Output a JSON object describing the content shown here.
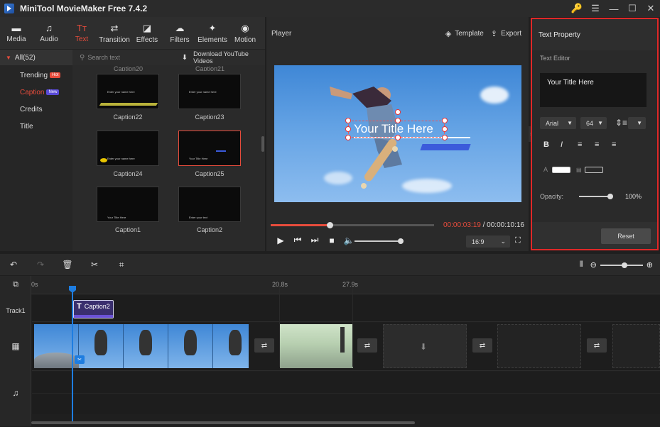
{
  "app": {
    "title": "MiniTool MovieMaker Free 7.4.2"
  },
  "toolbar": [
    {
      "label": "Media",
      "icon": "folder-icon",
      "glyph": "▬"
    },
    {
      "label": "Audio",
      "icon": "music-note-icon",
      "glyph": "♫"
    },
    {
      "label": "Text",
      "icon": "text-icon",
      "glyph": "Tт",
      "active": true
    },
    {
      "label": "Transition",
      "icon": "transition-icon",
      "glyph": "⇄"
    },
    {
      "label": "Effects",
      "icon": "effects-icon",
      "glyph": "◪"
    },
    {
      "label": "Filters",
      "icon": "filters-icon",
      "glyph": "☁"
    },
    {
      "label": "Elements",
      "icon": "elements-icon",
      "glyph": "✦"
    },
    {
      "label": "Motion",
      "icon": "motion-icon",
      "glyph": "◉"
    }
  ],
  "categories": {
    "header": "All(52)",
    "items": [
      {
        "label": "Trending",
        "badge": "Hot"
      },
      {
        "label": "Caption",
        "badge": "New",
        "active": true
      },
      {
        "label": "Credits"
      },
      {
        "label": "Title"
      }
    ]
  },
  "library": {
    "search_placeholder": "Search text",
    "youtube_label": "Download YouTube Videos",
    "partial_labels": [
      "Caption20",
      "Caption21"
    ],
    "items": [
      {
        "label": "Caption22",
        "preview": "Enter your name here"
      },
      {
        "label": "Caption23",
        "preview": "Enter your name here"
      },
      {
        "label": "Caption24",
        "preview": "Enter your name here"
      },
      {
        "label": "Caption25",
        "preview": "Your Title Here",
        "selected": true
      },
      {
        "label": "Caption1",
        "preview": "Your Title Here"
      },
      {
        "label": "Caption2",
        "preview": "Enter your text"
      }
    ]
  },
  "player": {
    "label": "Player",
    "template_label": "Template",
    "export_label": "Export",
    "overlay_title": "Your Title Here",
    "current_time": "00:00:03:19",
    "total_time": "/ 00:00:10:16",
    "aspect_ratio": "16:9",
    "progress_fraction": 0.36,
    "volume_fraction": 1.0
  },
  "text_property": {
    "header": "Text Property",
    "editor_label": "Text Editor",
    "editor_value": "Your Title Here",
    "font": "Arial",
    "size": "64",
    "opacity_label": "Opacity:",
    "opacity_value": "100%",
    "reset_label": "Reset"
  },
  "timeline": {
    "ticks": [
      "0s",
      "20.8s",
      "27.9s"
    ],
    "track1_label": "Track1",
    "caption_clip_label": "Caption2"
  },
  "colors": {
    "accent": "#e74c3c",
    "highlight_border": "#e02828",
    "playhead": "#1e7de0",
    "caption_clip": "#3a2f6e"
  }
}
